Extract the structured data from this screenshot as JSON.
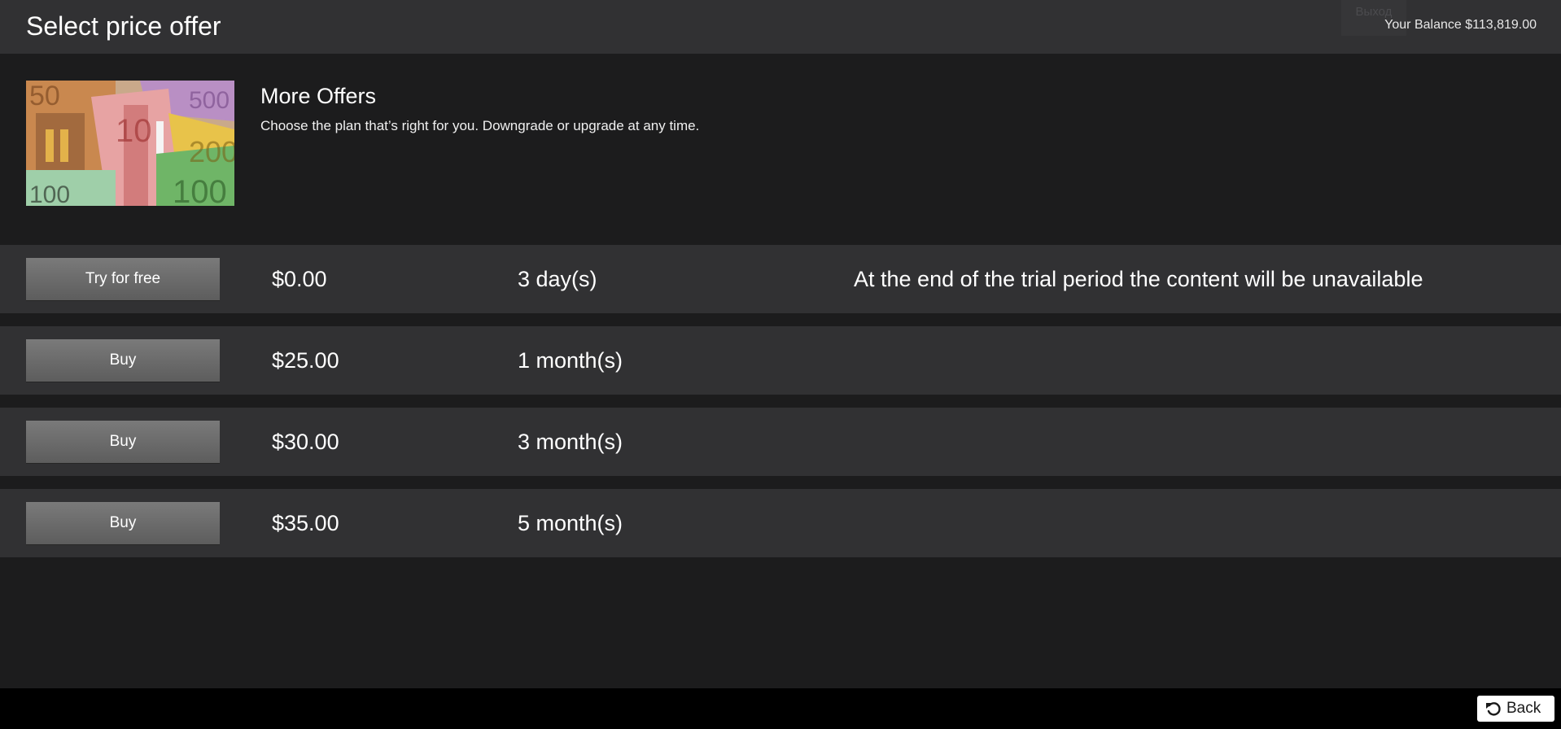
{
  "header": {
    "title": "Select price offer",
    "exit_label": "Выход",
    "balance": "Your Balance $113,819.00"
  },
  "offer": {
    "image_icon": "euro-banknotes-image",
    "title": "More Offers",
    "description": "Choose the plan that’s right for you. Downgrade or upgrade at any time."
  },
  "plans": [
    {
      "button": "Try for free",
      "price": "$0.00",
      "period": "3 day(s)",
      "note": "At the end of the trial period the content will be unavailable"
    },
    {
      "button": "Buy",
      "price": "$25.00",
      "period": "1 month(s)",
      "note": ""
    },
    {
      "button": "Buy",
      "price": "$30.00",
      "period": "3 month(s)",
      "note": ""
    },
    {
      "button": "Buy",
      "price": "$35.00",
      "period": "5 month(s)",
      "note": ""
    }
  ],
  "footer": {
    "back_label": "Back",
    "back_icon": "undo-arrow-icon"
  },
  "colors": {
    "background": "#1c1c1d",
    "header": "#313133",
    "row": "#313133",
    "button": "#6b6b6b",
    "footer": "#000000"
  }
}
